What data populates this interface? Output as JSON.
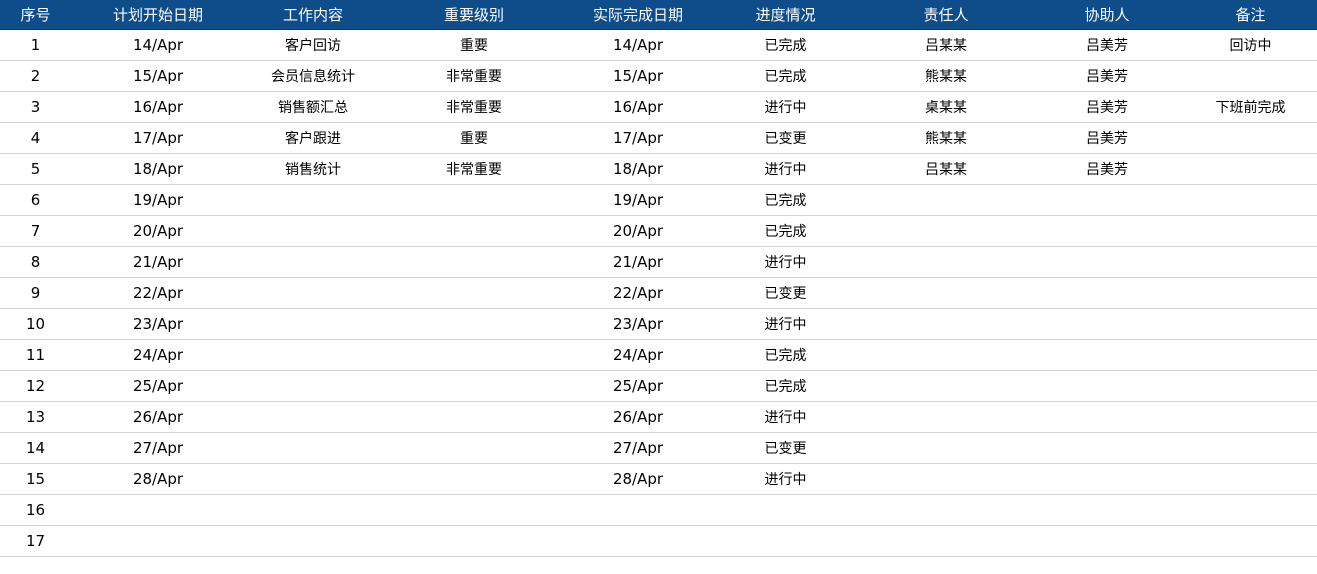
{
  "colors": {
    "header_bg": "#0f4c8a",
    "header_text": "#ffffff",
    "row_border": "#cfd3d8"
  },
  "headers": [
    "序号",
    "计划开始日期",
    "工作内容",
    "重要级别",
    "实际完成日期",
    "进度情况",
    "责任人",
    "协助人",
    "备注"
  ],
  "rows": [
    [
      "1",
      "14/Apr",
      "客户回访",
      "重要",
      "14/Apr",
      "已完成",
      "吕某某",
      "吕美芳",
      "回访中"
    ],
    [
      "2",
      "15/Apr",
      "会员信息统计",
      "非常重要",
      "15/Apr",
      "已完成",
      "熊某某",
      "吕美芳",
      ""
    ],
    [
      "3",
      "16/Apr",
      "销售额汇总",
      "非常重要",
      "16/Apr",
      "进行中",
      "桌某某",
      "吕美芳",
      "下班前完成"
    ],
    [
      "4",
      "17/Apr",
      "客户跟进",
      "重要",
      "17/Apr",
      "已变更",
      "熊某某",
      "吕美芳",
      ""
    ],
    [
      "5",
      "18/Apr",
      "销售统计",
      "非常重要",
      "18/Apr",
      "进行中",
      "吕某某",
      "吕美芳",
      ""
    ],
    [
      "6",
      "19/Apr",
      "",
      "",
      "19/Apr",
      "已完成",
      "",
      "",
      ""
    ],
    [
      "7",
      "20/Apr",
      "",
      "",
      "20/Apr",
      "已完成",
      "",
      "",
      ""
    ],
    [
      "8",
      "21/Apr",
      "",
      "",
      "21/Apr",
      "进行中",
      "",
      "",
      ""
    ],
    [
      "9",
      "22/Apr",
      "",
      "",
      "22/Apr",
      "已变更",
      "",
      "",
      ""
    ],
    [
      "10",
      "23/Apr",
      "",
      "",
      "23/Apr",
      "进行中",
      "",
      "",
      ""
    ],
    [
      "11",
      "24/Apr",
      "",
      "",
      "24/Apr",
      "已完成",
      "",
      "",
      ""
    ],
    [
      "12",
      "25/Apr",
      "",
      "",
      "25/Apr",
      "已完成",
      "",
      "",
      ""
    ],
    [
      "13",
      "26/Apr",
      "",
      "",
      "26/Apr",
      "进行中",
      "",
      "",
      ""
    ],
    [
      "14",
      "27/Apr",
      "",
      "",
      "27/Apr",
      "已变更",
      "",
      "",
      ""
    ],
    [
      "15",
      "28/Apr",
      "",
      "",
      "28/Apr",
      "进行中",
      "",
      "",
      ""
    ],
    [
      "16",
      "",
      "",
      "",
      "",
      "",
      "",
      "",
      ""
    ],
    [
      "17",
      "",
      "",
      "",
      "",
      "",
      "",
      "",
      ""
    ]
  ]
}
